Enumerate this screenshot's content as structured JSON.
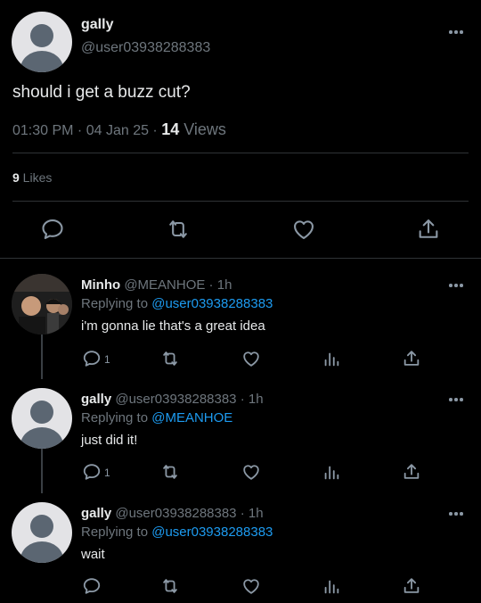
{
  "main_tweet": {
    "display_name": "gally",
    "handle": "@user03938288383",
    "text": "should i get a buzz cut?",
    "timestamp": "01:30 PM · 04 Jan 25 · ",
    "views_count": "14",
    "views_label": " Views",
    "likes_count": "9",
    "likes_label": " Likes"
  },
  "replies": [
    {
      "display_name": "Minho",
      "meta": " @MEANHOE · 1h",
      "replying_prefix": "Replying to ",
      "replying_to": "@user03938288383",
      "text": "i'm gonna lie that's a great idea",
      "reply_count": "1"
    },
    {
      "display_name": "gally",
      "meta": " @user03938288383 · 1h",
      "replying_prefix": "Replying to ",
      "replying_to": "@MEANHOE",
      "text": "just did it!",
      "reply_count": "1"
    },
    {
      "display_name": "gally",
      "meta": " @user03938288383 · 1h",
      "replying_prefix": "Replying to ",
      "replying_to": "@user03938288383",
      "text": "wait",
      "reply_count": ""
    }
  ],
  "colors": {
    "background": "#000000",
    "accent": "#1d9bf0",
    "secondary_text": "#6e767d"
  }
}
